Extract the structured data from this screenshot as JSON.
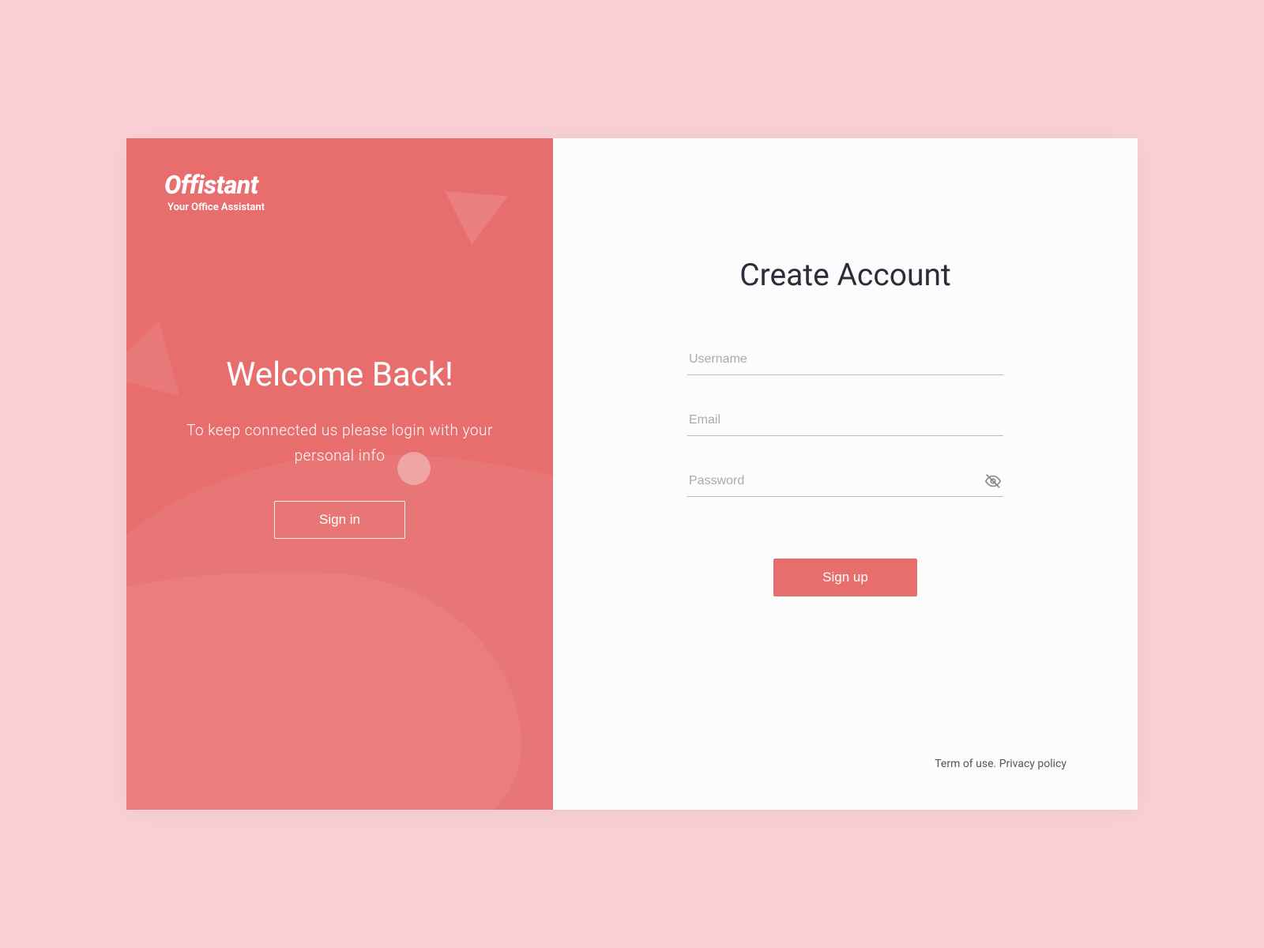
{
  "brand": {
    "name": "Offistant",
    "tagline": "Your Office Assistant"
  },
  "left": {
    "title": "Welcome Back!",
    "subtitle": "To keep connected us please login with your personal info",
    "signin_label": "Sign in"
  },
  "form": {
    "title": "Create Account",
    "username_placeholder": "Username",
    "email_placeholder": "Email",
    "password_placeholder": "Password",
    "signup_label": "Sign up"
  },
  "footer": {
    "terms": "Term of use.",
    "privacy": "Privacy policy"
  },
  "colors": {
    "accent": "#e86e6e",
    "background": "#f9d1d4"
  }
}
